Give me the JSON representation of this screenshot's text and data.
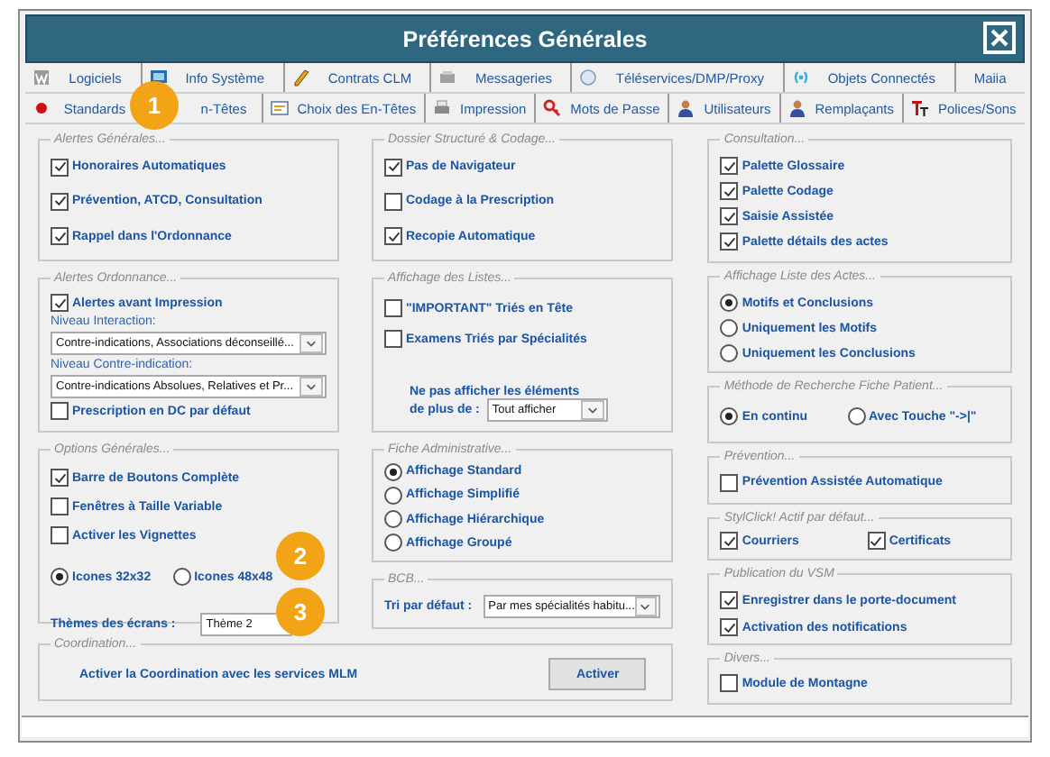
{
  "window": {
    "title": "Préférences Générales"
  },
  "tab_rows": [
    [
      {
        "label": "Logiciels"
      },
      {
        "label": "Info Système"
      },
      {
        "label": "Contrats CLM"
      },
      {
        "label": "Messageries"
      },
      {
        "label": "Téléservices/DMP/Proxy"
      },
      {
        "label": "Objets Connectés"
      },
      {
        "label": "Maiia"
      }
    ],
    [
      {
        "label": "Standards"
      },
      {
        "label": "n-Têtes"
      },
      {
        "label": "Choix des En-Têtes"
      },
      {
        "label": "Impression"
      },
      {
        "label": "Mots de Passe"
      },
      {
        "label": "Utilisateurs"
      },
      {
        "label": "Remplaçants"
      },
      {
        "label": "Polices/Sons"
      }
    ]
  ],
  "columns": [
    [
      {
        "title": "Alertes Générales...",
        "rows": [
          [
            {
              "kind": "checkbox",
              "label": "Honoraires Automatiques",
              "checked": true
            }
          ],
          [
            {
              "kind": "checkbox",
              "label": "Prévention, ATCD, Consultation",
              "checked": true
            }
          ],
          [
            {
              "kind": "checkbox",
              "label": "Rappel dans l'Ordonnance",
              "checked": true
            }
          ]
        ]
      },
      {
        "title": "Alertes Ordonnance...",
        "rows": [
          [
            {
              "kind": "checkbox",
              "label": "Alertes avant Impression",
              "checked": true
            }
          ],
          [
            {
              "kind": "caption",
              "label": "Niveau Interaction:"
            }
          ],
          [
            {
              "kind": "dropdown",
              "value": "Contre-indications, Associations déconseillé..."
            }
          ],
          [
            {
              "kind": "caption",
              "label": "Niveau Contre-indication:"
            }
          ],
          [
            {
              "kind": "dropdown",
              "value": "Contre-indications Absolues, Relatives et Pr..."
            }
          ],
          [
            {
              "kind": "checkbox",
              "label": "Prescription en DC par défaut",
              "checked": false
            }
          ]
        ]
      },
      {
        "title": "Options Générales...",
        "rows": [
          [
            {
              "kind": "checkbox",
              "label": "Barre de Boutons Complète",
              "checked": true
            }
          ],
          [
            {
              "kind": "checkbox",
              "label": "Fenêtres à Taille Variable",
              "checked": false
            }
          ],
          [
            {
              "kind": "checkbox",
              "label": "Activer les Vignettes",
              "checked": false
            }
          ],
          [
            {
              "kind": "radio",
              "label": "Icones 32x32",
              "selected": true
            },
            {
              "kind": "radio",
              "label": "Icones 48x48",
              "selected": false
            }
          ],
          [
            {
              "kind": "text",
              "label": "Thèmes des écrans :"
            },
            {
              "kind": "textbox",
              "value": "Thème 2"
            }
          ]
        ]
      }
    ],
    [
      {
        "title": "Dossier Structuré & Codage...",
        "rows": [
          [
            {
              "kind": "checkbox",
              "label": "Pas de Navigateur",
              "checked": true
            }
          ],
          [
            {
              "kind": "checkbox",
              "label": "Codage à la Prescription",
              "checked": false
            }
          ],
          [
            {
              "kind": "checkbox",
              "label": "Recopie Automatique",
              "checked": true
            }
          ]
        ]
      },
      {
        "title": "Affichage des Listes...",
        "rows": [
          [
            {
              "kind": "checkbox",
              "label": "\"IMPORTANT\" Triés en Tête",
              "checked": false
            }
          ],
          [
            {
              "kind": "checkbox",
              "label": "Examens Triés par Spécialités",
              "checked": false
            }
          ],
          [
            {
              "kind": "text",
              "label": "Ne pas afficher les éléments"
            }
          ],
          [
            {
              "kind": "text",
              "label": "de plus de :"
            },
            {
              "kind": "dropdown",
              "value": "Tout afficher"
            }
          ]
        ]
      },
      {
        "title": "Fiche Administrative...",
        "rows": [
          [
            {
              "kind": "radio",
              "label": "Affichage Standard",
              "selected": true
            }
          ],
          [
            {
              "kind": "radio",
              "label": "Affichage Simplifié",
              "selected": false
            }
          ],
          [
            {
              "kind": "radio",
              "label": "Affichage Hiérarchique",
              "selected": false
            }
          ],
          [
            {
              "kind": "radio",
              "label": "Affichage Groupé",
              "selected": false
            }
          ]
        ]
      },
      {
        "title": "BCB...",
        "rows": [
          [
            {
              "kind": "text",
              "label": "Tri par défaut :"
            },
            {
              "kind": "dropdown",
              "value": "Par mes spécialités habitu..."
            }
          ]
        ]
      }
    ],
    [
      {
        "title": "Consultation...",
        "rows": [
          [
            {
              "kind": "checkbox",
              "label": "Palette Glossaire",
              "checked": true
            }
          ],
          [
            {
              "kind": "checkbox",
              "label": "Palette Codage",
              "checked": true
            }
          ],
          [
            {
              "kind": "checkbox",
              "label": "Saisie Assistée",
              "checked": true
            }
          ],
          [
            {
              "kind": "checkbox",
              "label": "Palette détails des actes",
              "checked": true
            }
          ]
        ]
      },
      {
        "title": "Affichage Liste des Actes...",
        "rows": [
          [
            {
              "kind": "radio",
              "label": "Motifs et Conclusions",
              "selected": true
            }
          ],
          [
            {
              "kind": "radio",
              "label": "Uniquement les Motifs",
              "selected": false
            }
          ],
          [
            {
              "kind": "radio",
              "label": "Uniquement les Conclusions",
              "selected": false
            }
          ]
        ]
      },
      {
        "title": "Méthode de Recherche Fiche Patient...",
        "rows": [
          [
            {
              "kind": "radio",
              "label": "En continu",
              "selected": true
            },
            {
              "kind": "radio",
              "label": "Avec Touche \"->|\"",
              "selected": false
            }
          ]
        ]
      },
      {
        "title": "Prévention...",
        "rows": [
          [
            {
              "kind": "checkbox",
              "label": "Prévention Assistée Automatique",
              "checked": false
            }
          ]
        ]
      },
      {
        "title": "StylClick! Actif par défaut...",
        "rows": [
          [
            {
              "kind": "checkbox",
              "label": "Courriers",
              "checked": true
            },
            {
              "kind": "checkbox",
              "label": "Certificats",
              "checked": true
            }
          ]
        ]
      },
      {
        "title": "Publication du VSM",
        "rows": [
          [
            {
              "kind": "checkbox",
              "label": "Enregistrer dans le porte-document",
              "checked": true
            }
          ],
          [
            {
              "kind": "checkbox",
              "label": "Activation des notifications",
              "checked": true
            }
          ]
        ]
      },
      {
        "title": "Divers...",
        "rows": [
          [
            {
              "kind": "checkbox",
              "label": "Module de Montagne",
              "checked": false
            }
          ]
        ]
      }
    ]
  ],
  "coordination": {
    "title": "Coordination...",
    "text": "Activer la Coordination avec les services MLM",
    "button": "Activer"
  },
  "callouts": [
    {
      "label": "1"
    },
    {
      "label": "2"
    },
    {
      "label": "3"
    }
  ]
}
